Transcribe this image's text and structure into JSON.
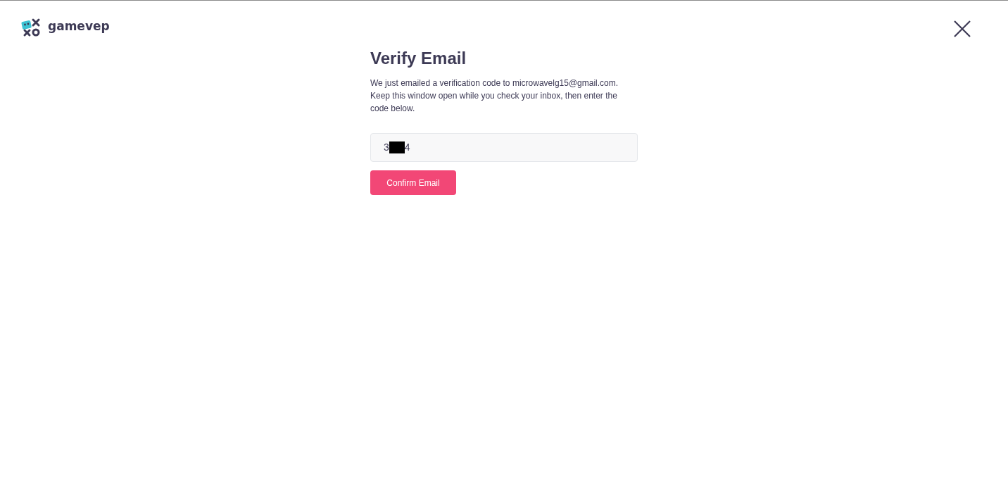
{
  "header": {
    "logo_text": "gamevep"
  },
  "verify": {
    "title": "Verify Email",
    "message": "We just emailed a verification code to microwavelg15@gmail.com. Keep this window open while you check your inbox, then enter the code below.",
    "code_field": {
      "value_start": "3",
      "value_end": "4",
      "redacted": true
    },
    "confirm_button": "Confirm Email"
  }
}
